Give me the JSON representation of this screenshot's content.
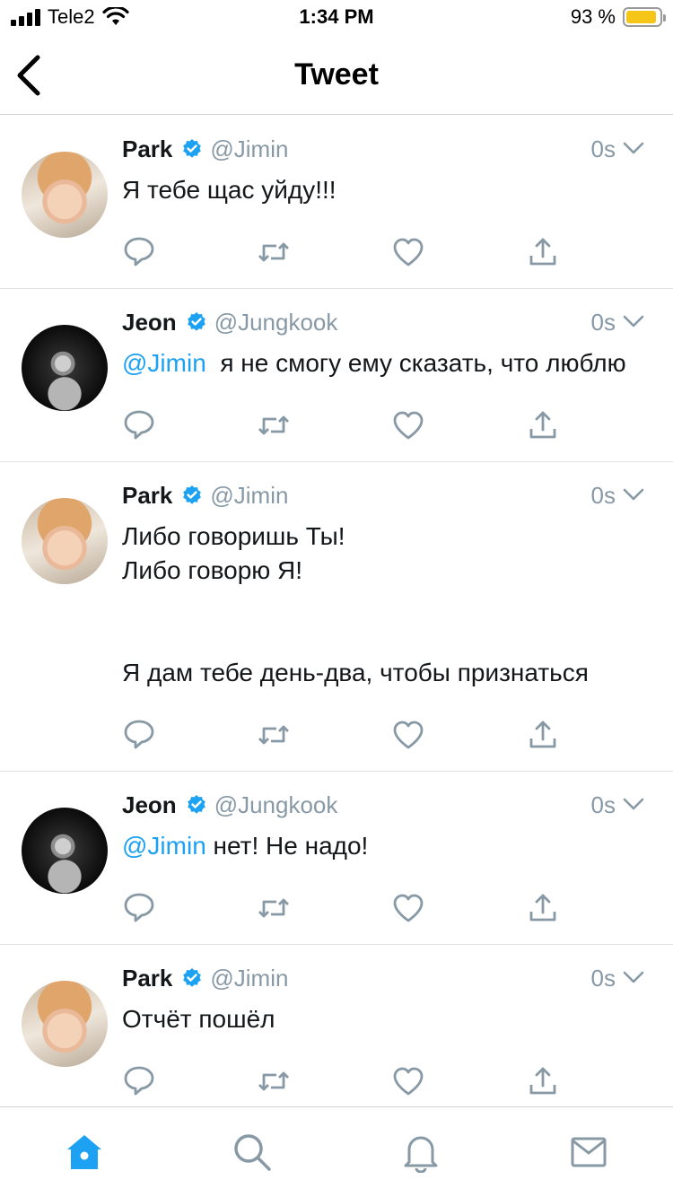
{
  "status_bar": {
    "carrier": "Tele2",
    "time": "1:34 PM",
    "battery": "93 %",
    "battery_level": 0.93
  },
  "nav": {
    "title": "Tweet"
  },
  "colors": {
    "accent": "#1da1f2",
    "muted": "#8899a6",
    "battery_fill": "#f5c518"
  },
  "tweets": [
    {
      "name": "Park",
      "handle": "@Jimin",
      "time": "0s",
      "mention": "",
      "text": "Я тебе щас уйду!!!"
    },
    {
      "name": "Jeon",
      "handle": "@Jungkook",
      "time": "0s",
      "mention": "@Jimin",
      "text": "  я не смогу ему сказать, что люблю"
    },
    {
      "name": "Park",
      "handle": "@Jimin",
      "time": "0s",
      "mention": "",
      "text": "Либо говоришь Ты!\nЛибо говорю Я!\n\n\nЯ дам тебе день-два, чтобы признаться"
    },
    {
      "name": "Jeon",
      "handle": "@Jungkook",
      "time": "0s",
      "mention": "@Jimin",
      "text": " нет! Не надо!"
    },
    {
      "name": "Park",
      "handle": "@Jimin",
      "time": "0s",
      "mention": "",
      "text": "Отчёт пошёл"
    }
  ],
  "tabs": [
    "home-icon",
    "search-icon",
    "notifications-icon",
    "messages-icon"
  ]
}
